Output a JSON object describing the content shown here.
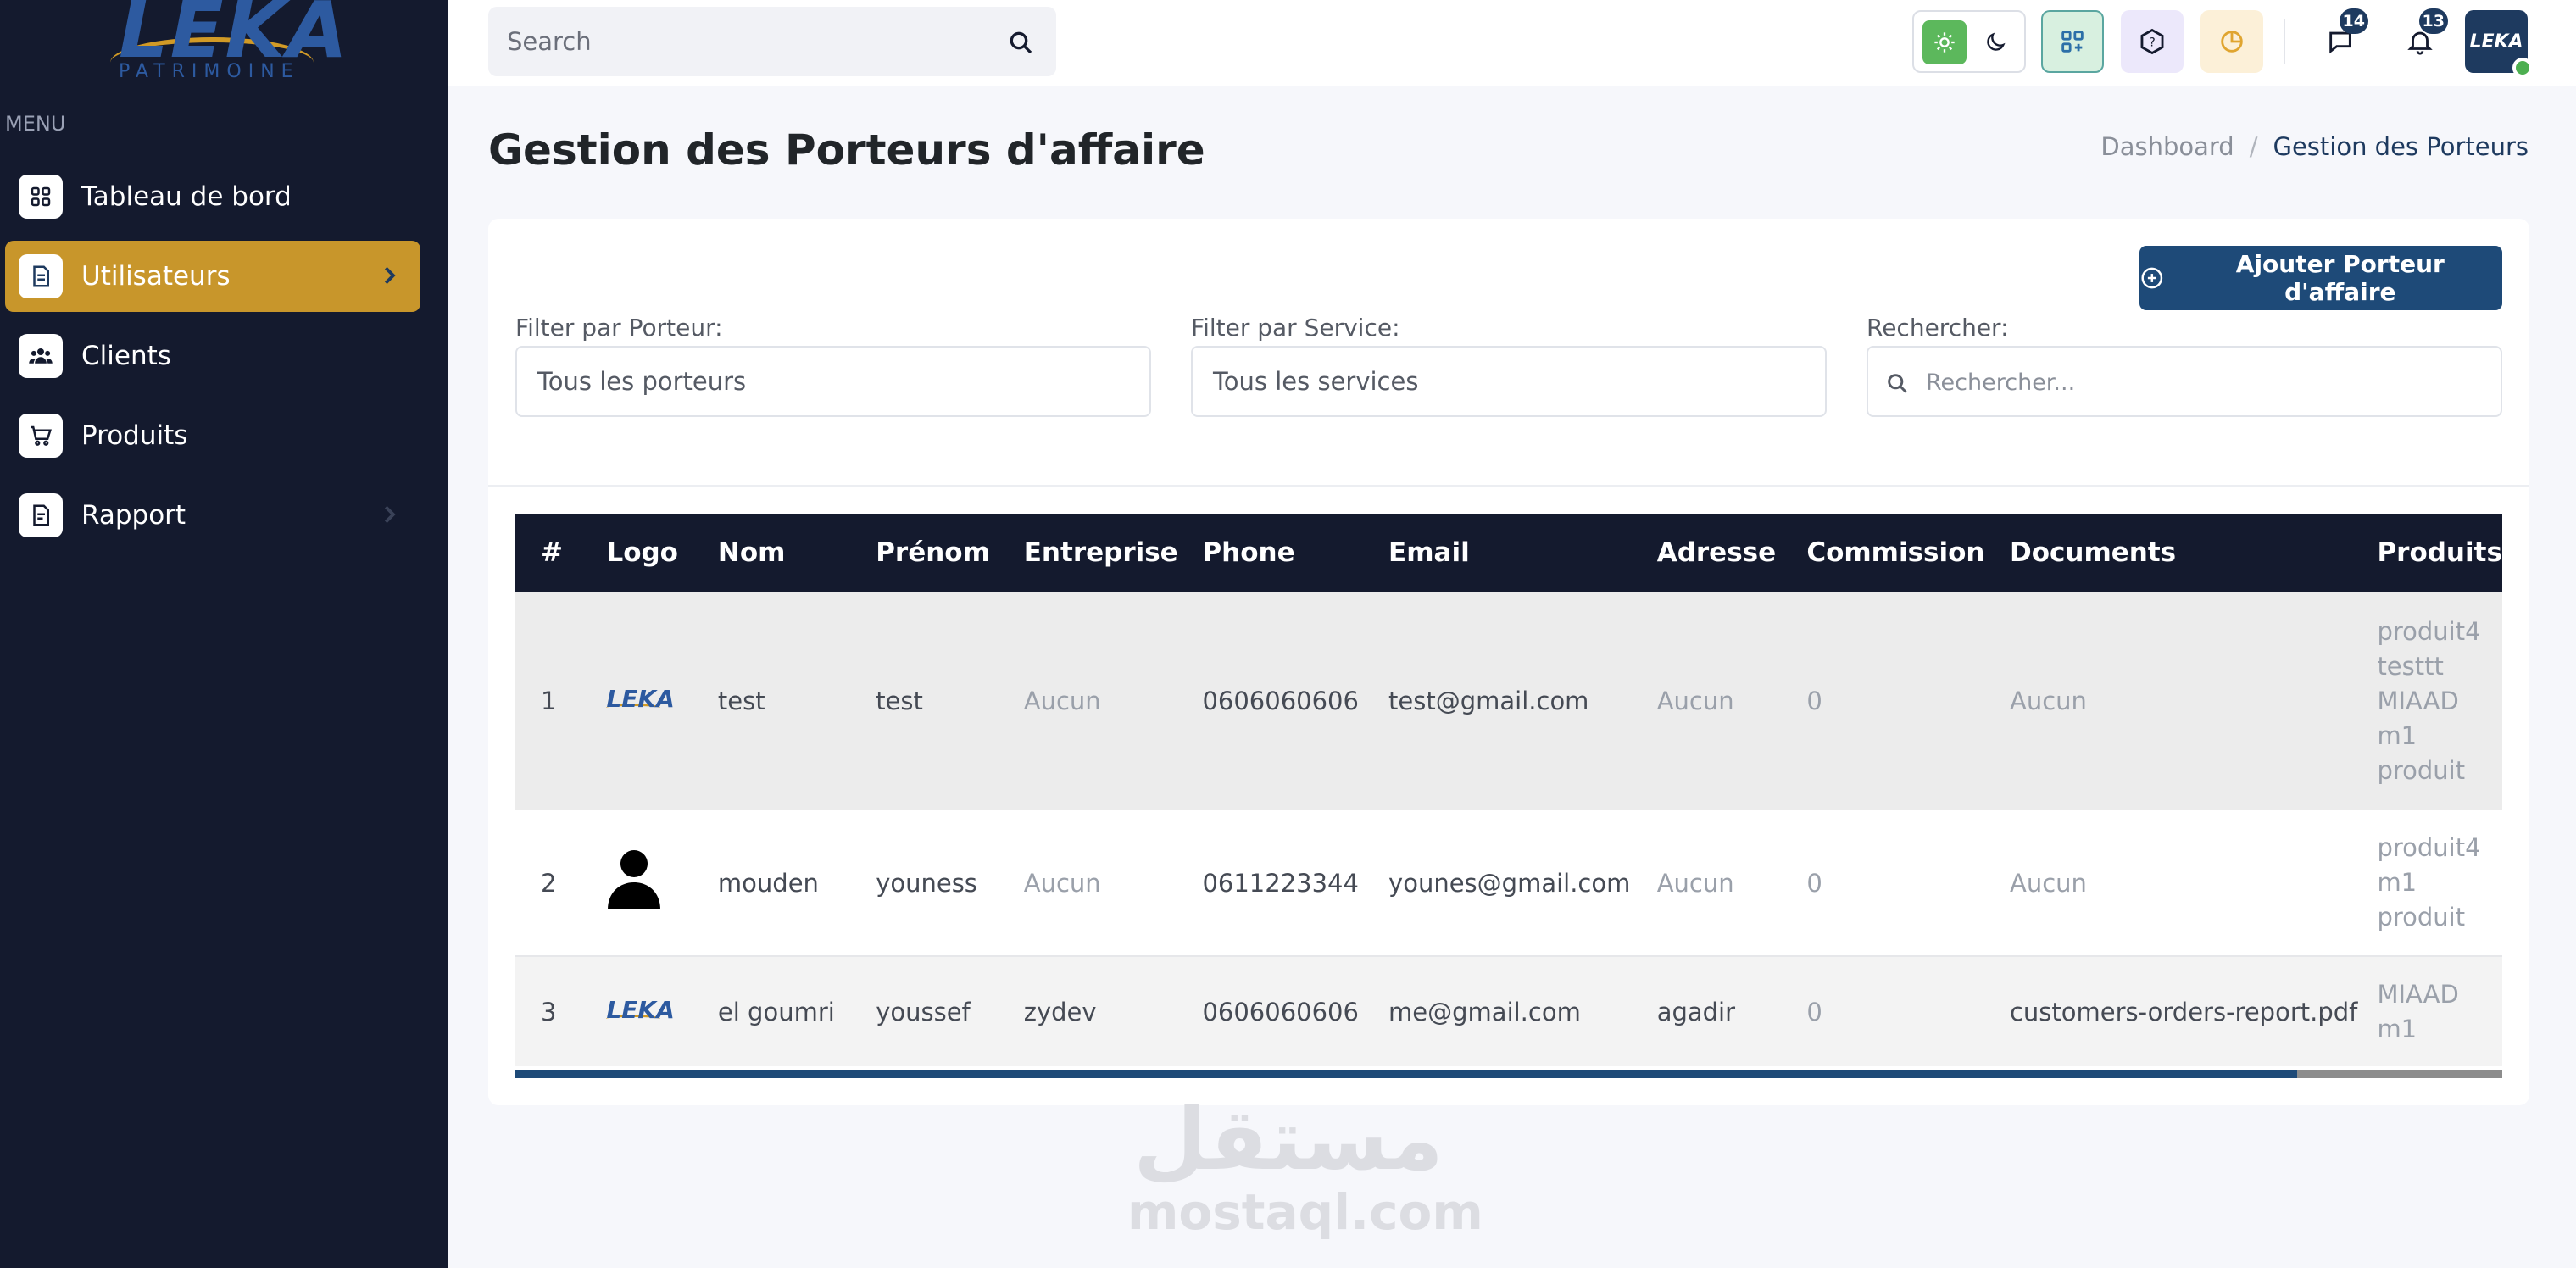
{
  "brand": {
    "logo_text": "LEKA",
    "logo_subtext": "PATRIMOINE",
    "avatar_text": "LEKA",
    "primary_color": "#1e4a78",
    "accent_color": "#c8962b",
    "sidebar_color": "#141a2e"
  },
  "sidebar": {
    "menu_label": "MENU",
    "items": [
      {
        "label": "Tableau de bord",
        "icon": "dashboard-grid-icon",
        "active": false
      },
      {
        "label": "Utilisateurs",
        "icon": "document-icon",
        "active": true,
        "has_chevron": true
      },
      {
        "label": "Clients",
        "icon": "users-icon",
        "active": false
      },
      {
        "label": "Produits",
        "icon": "cart-icon",
        "active": false
      },
      {
        "label": "Rapport",
        "icon": "report-icon",
        "active": false,
        "has_chevron": true
      }
    ]
  },
  "topbar": {
    "search_placeholder": "Search",
    "messages_count": "14",
    "notifications_count": "13"
  },
  "page": {
    "title": "Gestion des Porteurs d'affaire",
    "breadcrumb": [
      "Dashboard",
      "/",
      "Gestion des Porteurs"
    ]
  },
  "toolbar": {
    "add_button_label": "Ajouter Porteur d'affaire",
    "filter_porteur_label": "Filter par Porteur:",
    "filter_porteur_value": "Tous les porteurs",
    "filter_service_label": "Filter par Service:",
    "filter_service_value": "Tous les services",
    "search_label": "Rechercher:",
    "search_placeholder": "Rechercher..."
  },
  "table": {
    "columns": [
      "#",
      "Logo",
      "Nom",
      "Prénom",
      "Entreprise",
      "Phone",
      "Email",
      "Adresse",
      "Commission",
      "Documents",
      "Produits"
    ],
    "rows": [
      {
        "num": "1",
        "logo": "leka-logo",
        "nom": "test",
        "prenom": "test",
        "entreprise": "Aucun",
        "phone": "0606060606",
        "email": "test@gmail.com",
        "adresse": "Aucun",
        "commission": "0",
        "documents": "Aucun",
        "produits": [
          "produit4",
          "testtt",
          "MIAAD",
          "m1",
          "produit"
        ]
      },
      {
        "num": "2",
        "logo": "user-avatar",
        "nom": "mouden",
        "prenom": "youness",
        "entreprise": "Aucun",
        "phone": "0611223344",
        "email": "younes@gmail.com",
        "adresse": "Aucun",
        "commission": "0",
        "documents": "Aucun",
        "produits": [
          "produit4",
          "m1",
          "produit"
        ]
      },
      {
        "num": "3",
        "logo": "leka-logo",
        "nom": "el goumri",
        "prenom": "youssef",
        "entreprise": "zydev",
        "phone": "0606060606",
        "email": "me@gmail.com",
        "adresse": "agadir",
        "commission": "0",
        "documents": "customers-orders-report.pdf",
        "produits": [
          "MIAAD",
          "m1"
        ]
      }
    ],
    "horizontal_scroll_position": 0.9
  },
  "watermark": {
    "arabic": "مستقل",
    "latin": "mostaql.com"
  }
}
